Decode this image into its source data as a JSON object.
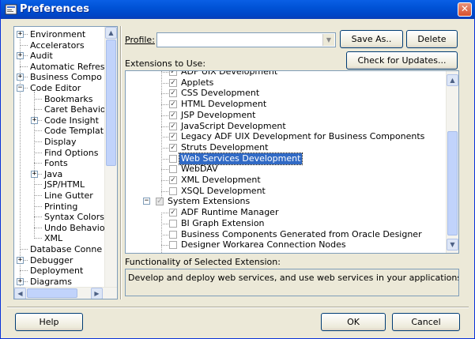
{
  "window": {
    "title": "Preferences",
    "close_glyph": "✕",
    "app_icon": "preferences-icon",
    "close_icon": "close-icon"
  },
  "left_tree": {
    "items": [
      {
        "label": "Environment",
        "expander": "+"
      },
      {
        "label": "Accelerators",
        "expander": ""
      },
      {
        "label": "Audit",
        "expander": "+"
      },
      {
        "label": "Automatic Refres",
        "expander": ""
      },
      {
        "label": "Business Compo",
        "expander": "+"
      },
      {
        "label": "Code Editor",
        "expander": "−"
      },
      {
        "label": "Bookmarks",
        "expander": ""
      },
      {
        "label": "Caret Behavio",
        "expander": ""
      },
      {
        "label": "Code Insight",
        "expander": "+"
      },
      {
        "label": "Code Templat",
        "expander": ""
      },
      {
        "label": "Display",
        "expander": ""
      },
      {
        "label": "Find Options",
        "expander": ""
      },
      {
        "label": "Fonts",
        "expander": ""
      },
      {
        "label": "Java",
        "expander": "+"
      },
      {
        "label": "JSP/HTML",
        "expander": ""
      },
      {
        "label": "Line Gutter",
        "expander": ""
      },
      {
        "label": "Printing",
        "expander": ""
      },
      {
        "label": "Syntax Colors",
        "expander": ""
      },
      {
        "label": "Undo Behavio",
        "expander": ""
      },
      {
        "label": "XML",
        "expander": ""
      },
      {
        "label": "Database Conne",
        "expander": ""
      },
      {
        "label": "Debugger",
        "expander": "+"
      },
      {
        "label": "Deployment",
        "expander": ""
      },
      {
        "label": "Diagrams",
        "expander": "+"
      }
    ],
    "scroll_up": "▲",
    "scroll_down": "▼",
    "scroll_left": "◀",
    "scroll_right": "▶"
  },
  "profile": {
    "label": "Profile:",
    "value": "",
    "arrow": "▼",
    "save_as": "Save As..",
    "delete": "Delete"
  },
  "extensions": {
    "label": "Extensions to Use:",
    "check_updates": "Check for Updates...",
    "items": [
      {
        "label": "ADF UIX Development",
        "checked": "✓"
      },
      {
        "label": "Applets",
        "checked": "✓"
      },
      {
        "label": "CSS Development",
        "checked": "✓"
      },
      {
        "label": "HTML Development",
        "checked": "✓"
      },
      {
        "label": "JSP Development",
        "checked": "✓"
      },
      {
        "label": "JavaScript Development",
        "checked": "✓"
      },
      {
        "label": "Legacy ADF UIX Development for Business Components",
        "checked": "✓"
      },
      {
        "label": "Struts Development",
        "checked": "✓"
      },
      {
        "label": "Web Services Development",
        "checked": ""
      },
      {
        "label": "WebDAV",
        "checked": ""
      },
      {
        "label": "XML Development",
        "checked": "✓"
      },
      {
        "label": "XSQL Development",
        "checked": ""
      },
      {
        "label": "System Extensions",
        "checked": "✓"
      },
      {
        "label": "ADF Runtime Manager",
        "checked": "✓"
      },
      {
        "label": "BI Graph Extension",
        "checked": ""
      },
      {
        "label": "Business Components Generated from Oracle Designer",
        "checked": ""
      },
      {
        "label": "Designer Workarea Connection Nodes",
        "checked": ""
      }
    ],
    "group_expander": "−",
    "scroll_up": "▲",
    "scroll_down": "▼"
  },
  "functionality": {
    "label": "Functionality of Selected Extension:",
    "description": "Develop and deploy web services, and use web services in your applications."
  },
  "footer": {
    "help": "Help",
    "ok": "OK",
    "cancel": "Cancel"
  }
}
